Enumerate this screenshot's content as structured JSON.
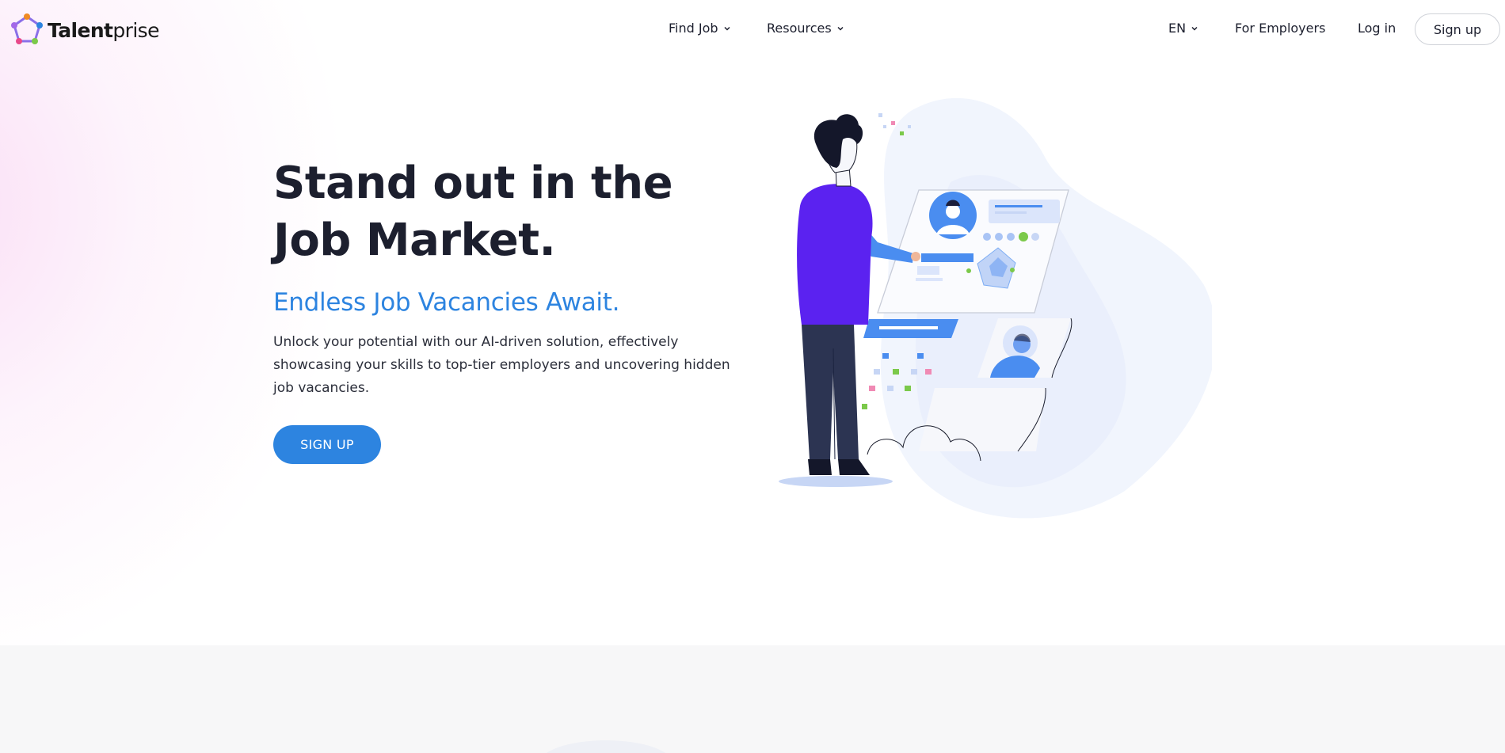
{
  "brand": {
    "name_bold": "Talent",
    "name_regular": "prise",
    "colors": {
      "accent": "#2d84e0",
      "shirt": "#5b22f0",
      "pants": "#2c3452",
      "illustration_blue": "#4a8df0"
    }
  },
  "nav": {
    "find_job": "Find Job",
    "resources": "Resources",
    "language": "EN",
    "for_employers": "For Employers",
    "login": "Log in",
    "signup": "Sign up"
  },
  "hero": {
    "title_line1": "Stand out in the",
    "title_line2": "Job Market.",
    "subtitle": "Endless Job Vacancies Await.",
    "description": "Unlock your potential with our AI-driven solution, effectively showcasing your skills to top-tier employers and uncovering hidden job vacancies.",
    "cta": "SIGN UP"
  },
  "icons": {
    "logo": "pentagon-logo-icon",
    "dropdown": "chevron-down-icon",
    "illustration": "person-with-profile-cards-illustration"
  }
}
